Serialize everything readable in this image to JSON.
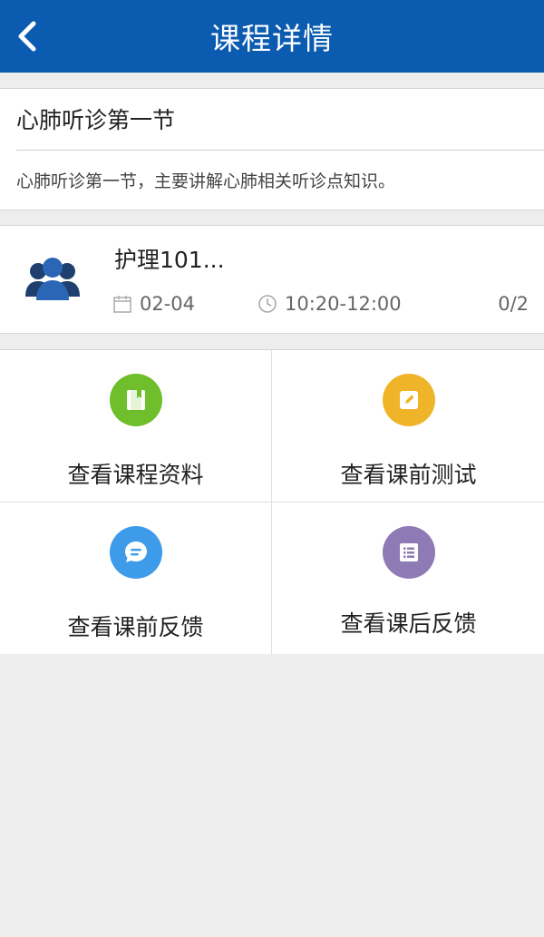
{
  "header": {
    "title": "课程详情",
    "back_icon": "chevron-left-icon",
    "color": "#0b5bb0"
  },
  "course": {
    "name": "心肺听诊第一节",
    "description": "心肺听诊第一节，主要讲解心肺相关听诊点知识。"
  },
  "session": {
    "class_name": "护理101...",
    "date": "02-04",
    "time": "10:20-12:00",
    "count": "0/2",
    "icons": [
      "group-icon",
      "calendar-icon",
      "clock-icon"
    ]
  },
  "actions": [
    {
      "label": "查看课程资料",
      "icon": "book-icon",
      "color": "#6fbf2c"
    },
    {
      "label": "查看课前测试",
      "icon": "edit-icon",
      "color": "#f0b429"
    },
    {
      "label": "查看课前反馈",
      "icon": "chat-icon",
      "color": "#3d9be9"
    },
    {
      "label": "查看课后反馈",
      "icon": "list-icon",
      "color": "#8e7bb5"
    }
  ]
}
